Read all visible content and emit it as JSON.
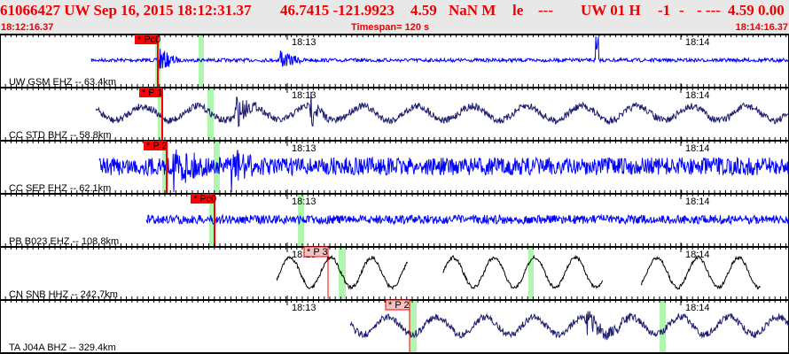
{
  "header": {
    "event": "61066427 UW Sep 16, 2015 18:12:31.37",
    "location": "46.7415 -121.9923",
    "depth": "4.59",
    "magnitude": "NaN M",
    "type": "le",
    "dash1": "---",
    "source": "UW 01 H",
    "flag": "-1",
    "dash2": "-",
    "dash3": "- ---",
    "values": "4.59 0.00",
    "start_time": "18:12:16.37",
    "timespan": "Timespan= 120 s",
    "end_time": "18:14:16.37"
  },
  "time_labels": [
    "18:13",
    "18:14"
  ],
  "colors": {
    "header_text": "#ee0000",
    "pick_auto": "#ff0000",
    "pick_final": "#f4c0c0",
    "window": "#b0f5b0"
  },
  "channels": [
    {
      "label": "UW GSM EHZ -- 63.4km",
      "pick": "* Pc0",
      "color": "#0000ff",
      "pick_style": "auto"
    },
    {
      "label": "CC STD BHZ -- 58.8km",
      "pick": "* P 1",
      "color": "#1c1c6e",
      "pick_style": "auto"
    },
    {
      "label": "CC SEP EHZ -- 62.1km",
      "pick": "* P 2",
      "color": "#0000ff",
      "pick_style": "auto"
    },
    {
      "label": "PB B023 EHZ -- 108.8km",
      "pick": "* Pc0",
      "color": "#0000ff",
      "pick_style": "auto"
    },
    {
      "label": "CN SNB HHZ -- 242.7km",
      "pick": "* P 3",
      "color": "#000000",
      "pick_style": "final"
    },
    {
      "label": "TA J04A BHZ -- 329.4km",
      "pick": "* P 2",
      "color": "#1c1c6e",
      "pick_style": "final"
    }
  ]
}
